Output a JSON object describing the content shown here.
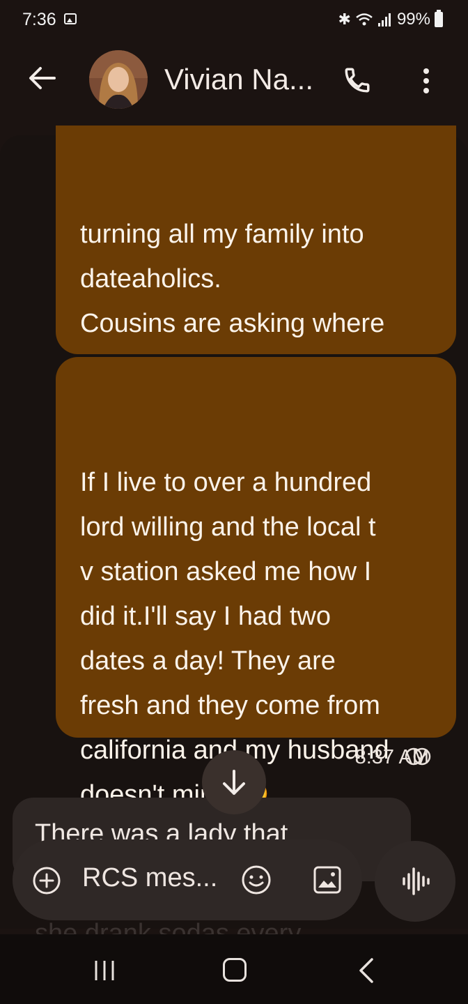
{
  "status_bar": {
    "time": "7:36",
    "battery": "99%",
    "bluetooth_icon": "bluetooth-icon",
    "wifi_icon": "wifi-icon",
    "signal_icon": "signal-icon",
    "gallery_icon": "gallery-notification-icon"
  },
  "app_bar": {
    "contact_name": "Vivian Na...",
    "back_icon": "arrow-left-icon",
    "call_icon": "phone-icon",
    "menu_icon": "more-vert-icon"
  },
  "messages": [
    {
      "direction": "sent",
      "text": "turning all my family into\ndateaholics.\nCousins are asking where\ni'm getting them and \"in\nlaws\"!"
    },
    {
      "direction": "sent",
      "text": "If I live to over a hundred\nlord willing and the local t\nv station asked me how I\ndid it.I'll say I had two\ndates a day! They are\nfresh and they come from\ncalifornia and my husband\ndoesn't mind!🤣"
    },
    {
      "direction": "received",
      "text": "There was a lady that"
    }
  ],
  "timestamp": "8:37 AM",
  "composer": {
    "placeholder": "RCS mes..."
  },
  "behind_composer_text": "she drank sodas every",
  "colors": {
    "sent_bubble": "#6b3c05",
    "received_bubble": "#2d2624",
    "background": "#1b1311"
  }
}
